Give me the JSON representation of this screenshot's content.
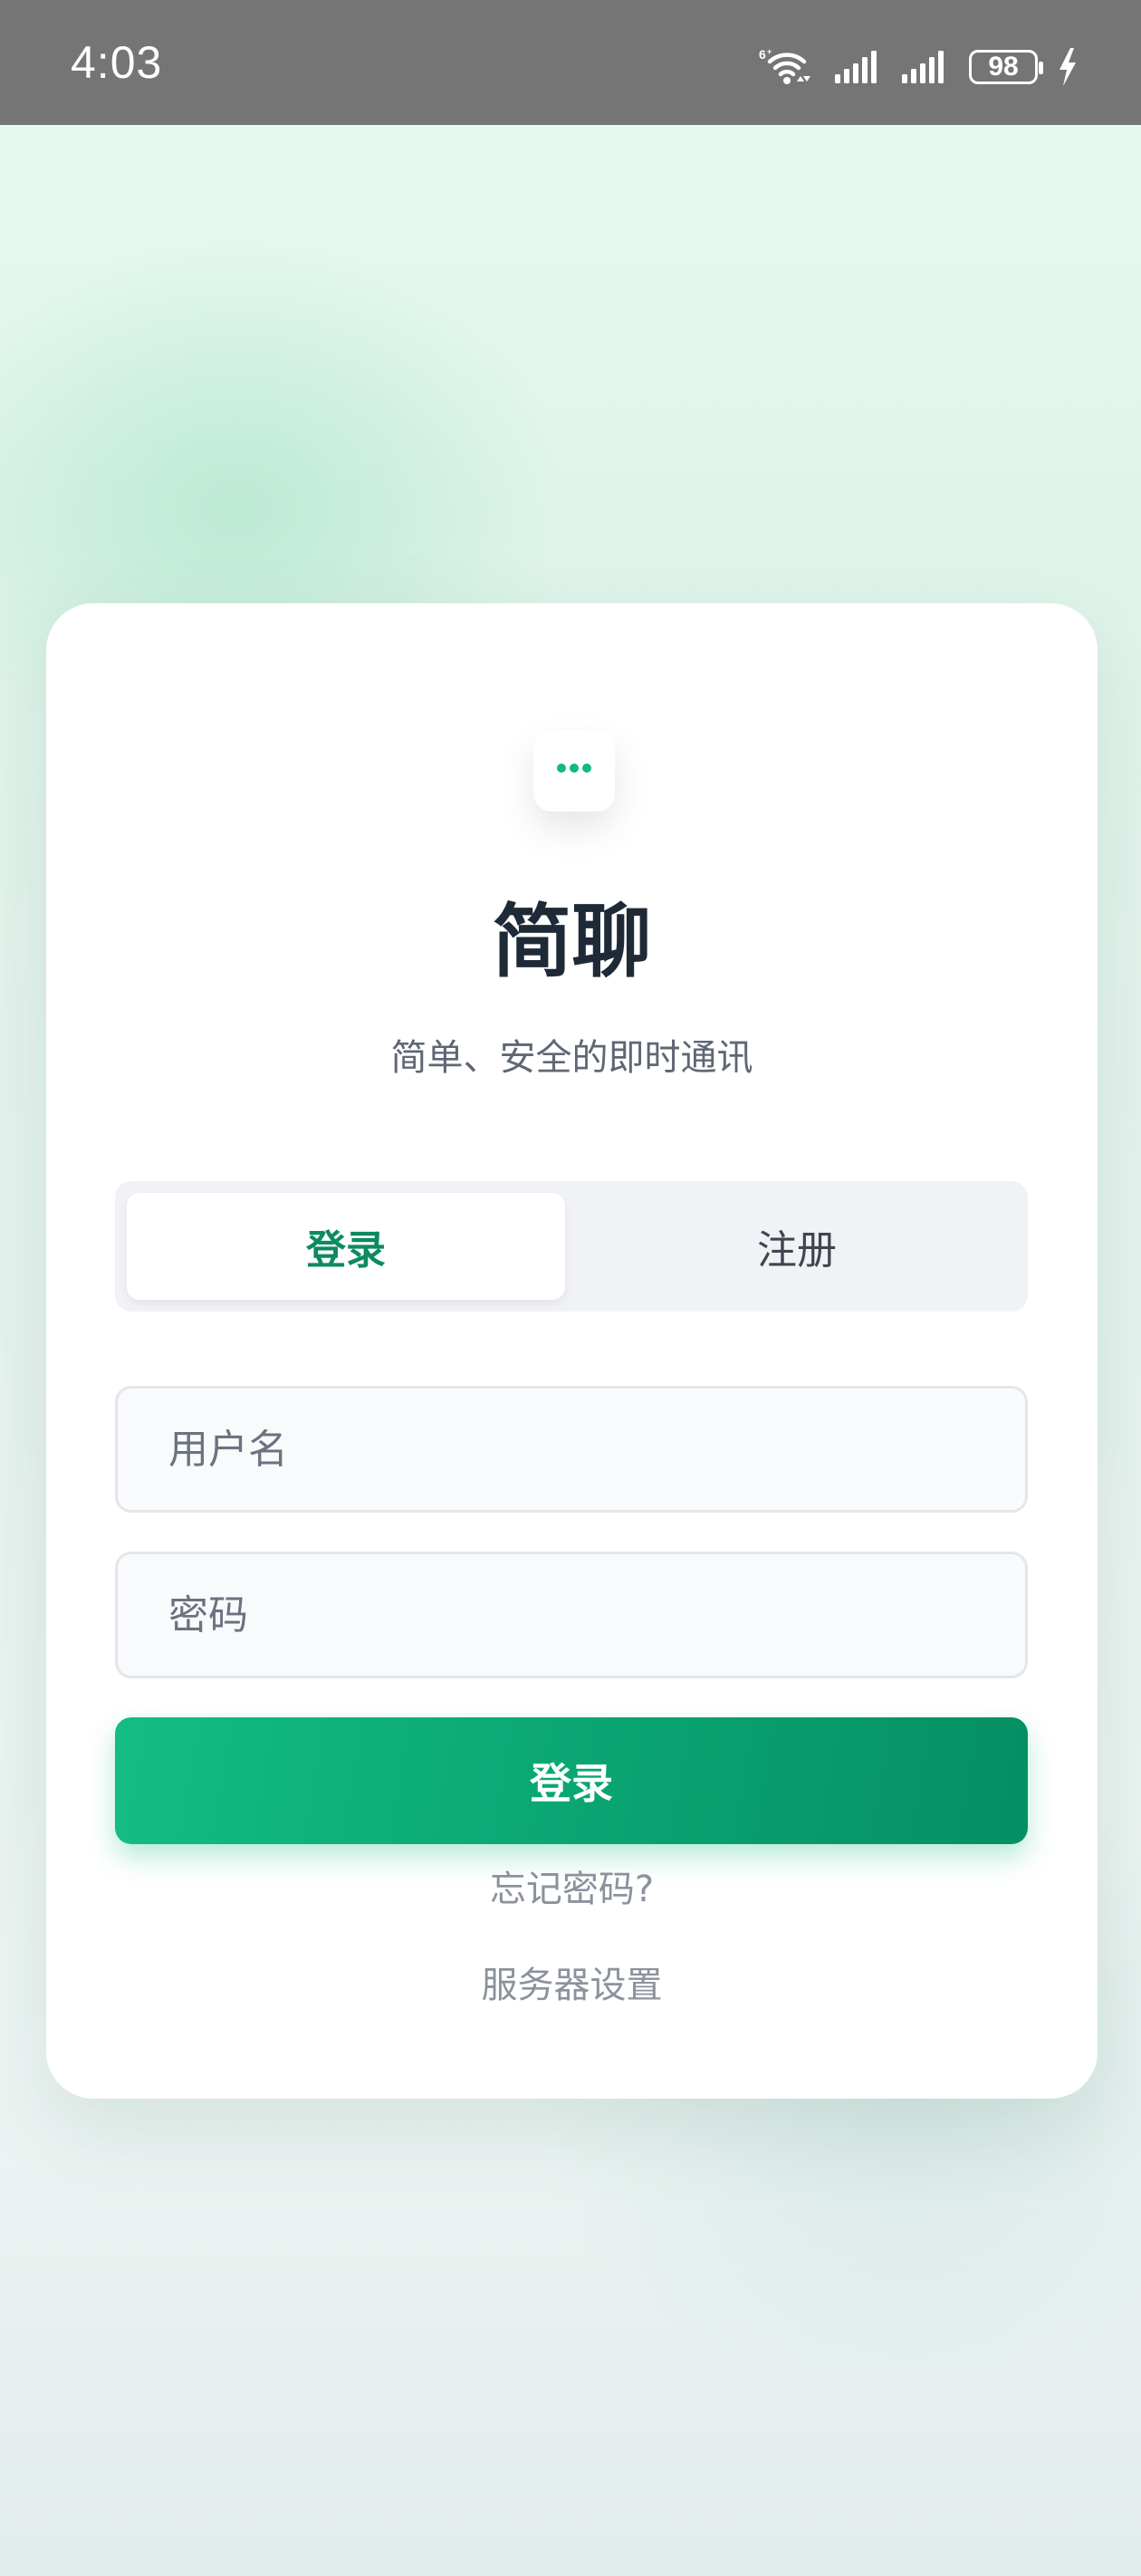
{
  "status_bar": {
    "time": "4:03",
    "battery_level": "98",
    "icons": [
      "wifi-6-icon",
      "signal-icon",
      "signal-icon",
      "battery-icon",
      "charging-icon"
    ]
  },
  "app": {
    "title": "简聊",
    "subtitle": "简单、安全的即时通讯",
    "logo_icon": "chat-bubble-icon"
  },
  "tabs": {
    "items": [
      {
        "label": "登录",
        "active": true
      },
      {
        "label": "注册",
        "active": false
      }
    ]
  },
  "form": {
    "username": {
      "value": "",
      "placeholder": "用户名"
    },
    "password": {
      "value": "",
      "placeholder": "密码"
    },
    "submit_label": "登录"
  },
  "links": {
    "forgot_password": "忘记密码?",
    "server_settings": "服务器设置"
  },
  "colors": {
    "accent": "#10b981",
    "accent_dark": "#058f63",
    "tab_active_text": "#0e8a5f",
    "title_text": "#1f2a37",
    "muted_text": "#8b929c",
    "status_bar_bg": "#757575"
  }
}
